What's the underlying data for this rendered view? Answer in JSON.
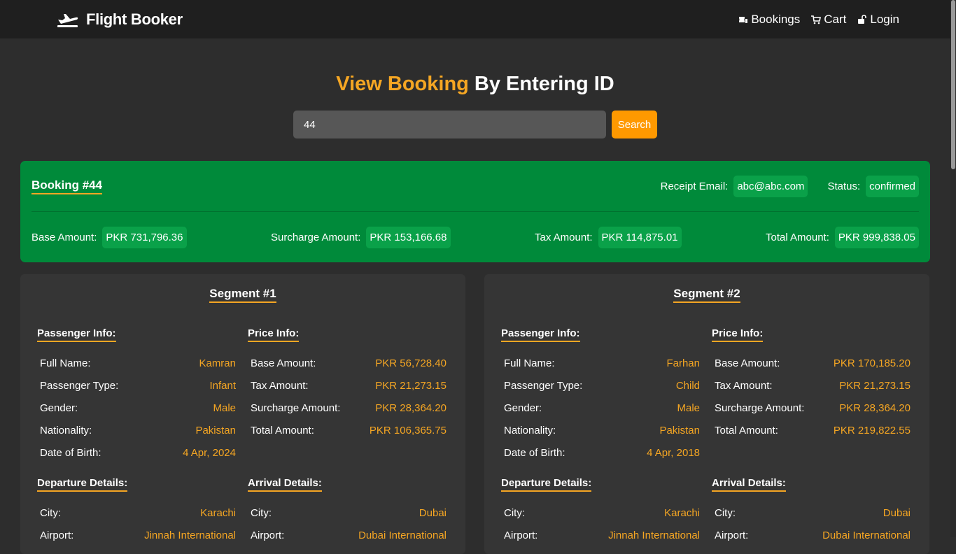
{
  "nav": {
    "brand": "Flight Booker",
    "links": [
      {
        "label": "Bookings",
        "icon": "ticket-icon"
      },
      {
        "label": "Cart",
        "icon": "cart-icon"
      },
      {
        "label": "Login",
        "icon": "unlock-icon"
      }
    ]
  },
  "page": {
    "title_accent": "View Booking",
    "title_rest": " By Entering ID"
  },
  "search": {
    "value": "44",
    "button_label": "Search"
  },
  "booking": {
    "title": "Booking #44",
    "receipt_email_label": "Receipt Email:",
    "receipt_email": "abc@abc.com",
    "status_label": "Status:",
    "status": "confirmed",
    "base_label": "Base Amount:",
    "base": "PKR 731,796.36",
    "surcharge_label": "Surcharge Amount:",
    "surcharge": "PKR 153,166.68",
    "tax_label": "Tax Amount:",
    "tax": "PKR 114,875.01",
    "total_label": "Total Amount:",
    "total": "PKR 999,838.05"
  },
  "segments": [
    {
      "title": "Segment #1",
      "passenger_heading": "Passenger Info:",
      "passenger": [
        {
          "k": "Full Name:",
          "v": "Kamran"
        },
        {
          "k": "Passenger Type:",
          "v": "Infant"
        },
        {
          "k": "Gender:",
          "v": "Male"
        },
        {
          "k": "Nationality:",
          "v": "Pakistan"
        },
        {
          "k": "Date of Birth:",
          "v": "4 Apr, 2024"
        }
      ],
      "price_heading": "Price Info:",
      "price": [
        {
          "k": "Base Amount:",
          "v": "PKR 56,728.40"
        },
        {
          "k": "Tax Amount:",
          "v": "PKR 21,273.15"
        },
        {
          "k": "Surcharge Amount:",
          "v": "PKR 28,364.20"
        },
        {
          "k": "Total Amount:",
          "v": "PKR 106,365.75"
        }
      ],
      "departure_heading": "Departure Details:",
      "departure": [
        {
          "k": "City:",
          "v": "Karachi"
        },
        {
          "k": "Airport:",
          "v": "Jinnah International"
        }
      ],
      "arrival_heading": "Arrival Details:",
      "arrival": [
        {
          "k": "City:",
          "v": "Dubai"
        },
        {
          "k": "Airport:",
          "v": "Dubai International"
        }
      ]
    },
    {
      "title": "Segment #2",
      "passenger_heading": "Passenger Info:",
      "passenger": [
        {
          "k": "Full Name:",
          "v": "Farhan"
        },
        {
          "k": "Passenger Type:",
          "v": "Child"
        },
        {
          "k": "Gender:",
          "v": "Male"
        },
        {
          "k": "Nationality:",
          "v": "Pakistan"
        },
        {
          "k": "Date of Birth:",
          "v": "4 Apr, 2018"
        }
      ],
      "price_heading": "Price Info:",
      "price": [
        {
          "k": "Base Amount:",
          "v": "PKR 170,185.20"
        },
        {
          "k": "Tax Amount:",
          "v": "PKR 21,273.15"
        },
        {
          "k": "Surcharge Amount:",
          "v": "PKR 28,364.20"
        },
        {
          "k": "Total Amount:",
          "v": "PKR 219,822.55"
        }
      ],
      "departure_heading": "Departure Details:",
      "departure": [
        {
          "k": "City:",
          "v": "Karachi"
        },
        {
          "k": "Airport:",
          "v": "Jinnah International"
        }
      ],
      "arrival_heading": "Arrival Details:",
      "arrival": [
        {
          "k": "City:",
          "v": "Dubai"
        },
        {
          "k": "Airport:",
          "v": "Dubai International"
        }
      ]
    }
  ]
}
